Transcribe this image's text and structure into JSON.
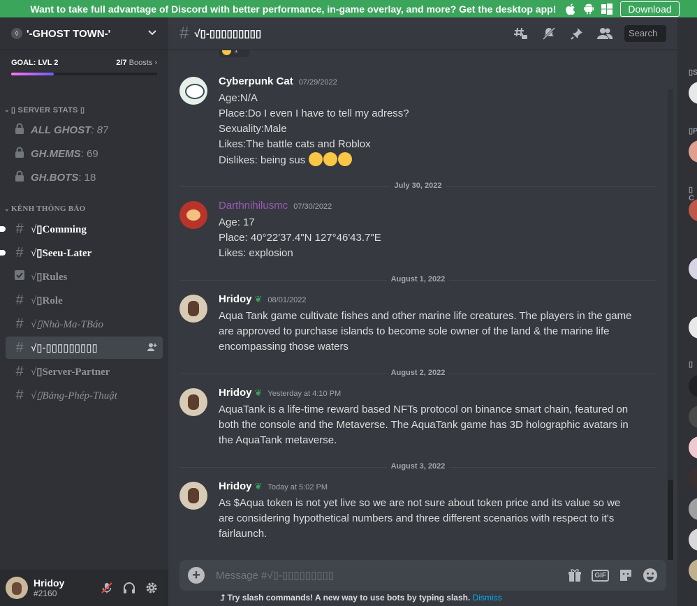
{
  "banner": {
    "text": "Want to take full advantage of Discord with better performance, in-game overlay, and more? Get the desktop app!",
    "download_label": "Download",
    "icons": [
      "apple-icon",
      "android-icon",
      "windows-icon"
    ]
  },
  "server": {
    "name": "'-GHOST TOWN-'",
    "boost_goal": "GOAL: LVL 2",
    "boost_count": "2/7",
    "boost_unit": "Boosts",
    "boost_progress": 0.29
  },
  "sidebar": {
    "stats_category": "▯ SERVER STATS ▯",
    "stats": [
      {
        "label": "ALL GHOST",
        "value": ": 87"
      },
      {
        "label": "GH.MEMS",
        "value": ": 69"
      },
      {
        "label": "GH.BOTS",
        "value": ": 18"
      }
    ],
    "announce_category": "KÊNH THÔNG BÁO",
    "channels": [
      {
        "name": "√▯Comming",
        "icon": "#",
        "unread": true
      },
      {
        "name": "√▯Seeu-Later",
        "icon": "#",
        "unread": true
      },
      {
        "name": "√▯Rules",
        "icon": "☑",
        "unread": false
      },
      {
        "name": "√▯Role",
        "icon": "#",
        "unread": false
      },
      {
        "name": "√▯Nhà-Ma-TBáo",
        "icon": "#",
        "unread": false
      },
      {
        "name": "√▯-▯▯▯▯▯▯▯▯▯",
        "icon": "#",
        "unread": false,
        "selected": true
      },
      {
        "name": "√▯Server-Partner",
        "icon": "#",
        "unread": false
      },
      {
        "name": "√▯Bảng-Phép-Thuật",
        "icon": "#",
        "unread": false
      }
    ]
  },
  "user": {
    "name": "Hridoy",
    "tag": "#2160"
  },
  "chat": {
    "title": "√▯-▯▯▯▯▯▯▯▯▯",
    "search_placeholder": "Search",
    "reaction_count": "1",
    "messages": [
      {
        "author": "Cyberpunk Cat",
        "timestamp": "07/29/2022",
        "lines": [
          "Age:N/A",
          "Place:Do I even I have to tell my adress?",
          "Sexuality:Male",
          "Likes:The battle cats and Roblox",
          "Dislikes: being sus"
        ]
      },
      {
        "author": "Darthnihilusmc",
        "timestamp": "07/30/2022",
        "lines": [
          "Age: 17",
          "Place: 40°22'37.4\"N 127°46'43.7\"E",
          "Likes: explosion"
        ]
      },
      {
        "author": "Hridoy",
        "timestamp": "08/01/2022",
        "lines": [
          "Aqua Tank game cultivate fishes and other marine life creatures. The players in the game",
          "are approved to purchase islands to become sole owner of the land & the marine life",
          "encompassing those waters"
        ]
      },
      {
        "author": "Hridoy",
        "timestamp": "Yesterday at 4:10 PM",
        "lines": [
          "AquaTank is a life-time reward based NFTs protocol on binance smart chain, featured on",
          "both the console and the Metaverse. The AquaTank game has 3D holographic avatars in",
          "the AquaTank metaverse."
        ]
      },
      {
        "author": "Hridoy",
        "timestamp": "Today at 5:02 PM",
        "lines": [
          "As $Aqua token is not yet live so we are not sure about token price and its value so we",
          "are considering hypothetical numbers and three different scenarios with respect to it's",
          "fairlaunch."
        ]
      }
    ],
    "dividers": [
      "July 30, 2022",
      "August 1, 2022",
      "August 2, 2022",
      "August 3, 2022"
    ],
    "composer_placeholder": "Message #√▯-▯▯▯▯▯▯▯▯▯",
    "slash_tip": "Try slash commands! A new way to use bots by typing slash.",
    "dismiss_label": "Dismiss"
  },
  "members": {
    "headers": [
      "▯S",
      "▯P",
      "▯ C",
      "▯"
    ],
    "avatar_colors": [
      "#e8e8e8",
      "#e0a090",
      "#c0584a",
      "#d8d4e8",
      "#e8e8e8",
      "#202225",
      "#4a4a4a",
      "#f0c8d0",
      "#3a3030",
      "#a0a0a0",
      "#d8d8d8",
      "#c0b090"
    ]
  }
}
